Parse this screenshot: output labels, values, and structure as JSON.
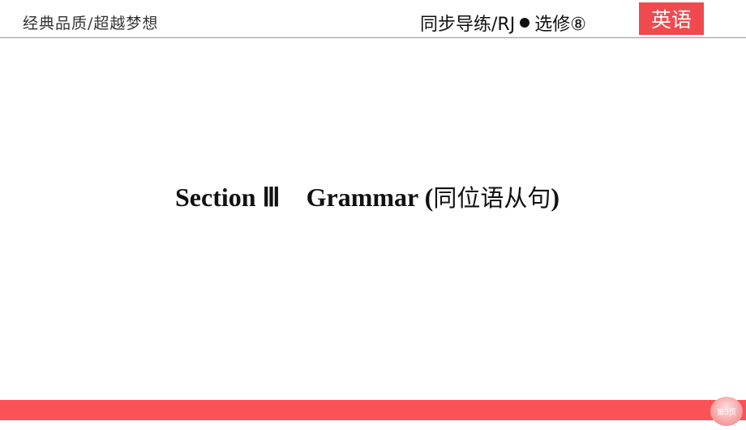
{
  "header": {
    "slogan": "经典品质/超越梦想",
    "series": "同步导练/RJ",
    "volume": "选修⑧",
    "subject": "英语"
  },
  "main": {
    "title_en": "Section Ⅲ　Grammar (",
    "title_cn": "同位语从句",
    "title_close": ")"
  },
  "footer": {
    "page_label": "第3页"
  },
  "colors": {
    "accent": "#fb5257",
    "subject_bg": "#f04a4e"
  }
}
